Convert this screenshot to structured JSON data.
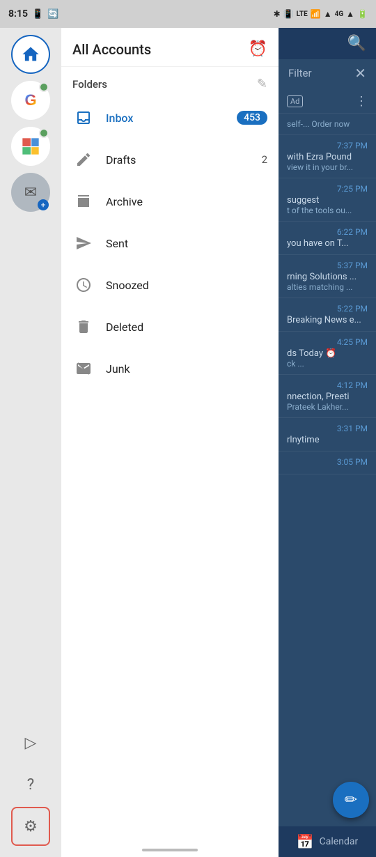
{
  "statusBar": {
    "time": "8:15",
    "icons": [
      "phone-icon",
      "sync-icon",
      "bluetooth-icon",
      "vibrate-icon",
      "lte-icon",
      "wifi-icon",
      "signal-icon",
      "4g-icon",
      "signal2-icon",
      "battery-icon"
    ]
  },
  "sidebar": {
    "accounts": [
      {
        "id": "home",
        "type": "home",
        "active": true
      },
      {
        "id": "google",
        "type": "google",
        "dot": true
      },
      {
        "id": "office",
        "type": "office",
        "dot": true
      },
      {
        "id": "add",
        "type": "add"
      }
    ],
    "bottomIcons": [
      {
        "id": "play",
        "icon": "▷"
      },
      {
        "id": "help",
        "icon": "?"
      },
      {
        "id": "settings",
        "icon": "⚙",
        "active": true
      }
    ]
  },
  "folderPanel": {
    "title": "All Accounts",
    "foldersLabel": "Folders",
    "folders": [
      {
        "id": "inbox",
        "label": "Inbox",
        "icon": "inbox",
        "count": "453",
        "active": true
      },
      {
        "id": "drafts",
        "label": "Drafts",
        "icon": "drafts",
        "count": "2"
      },
      {
        "id": "archive",
        "label": "Archive",
        "icon": "archive",
        "count": ""
      },
      {
        "id": "sent",
        "label": "Sent",
        "icon": "sent",
        "count": ""
      },
      {
        "id": "snoozed",
        "label": "Snoozed",
        "icon": "snoozed",
        "count": ""
      },
      {
        "id": "deleted",
        "label": "Deleted",
        "icon": "deleted",
        "count": ""
      },
      {
        "id": "junk",
        "label": "Junk",
        "icon": "junk",
        "count": ""
      }
    ]
  },
  "emailPanel": {
    "filterLabel": "Filter",
    "emails": [
      {
        "time": "7:37 PM",
        "subject": "with Ezra Pound",
        "preview": "view it in your br..."
      },
      {
        "time": "7:25 PM",
        "subject": "suggest",
        "preview": "t of the tools ou..."
      },
      {
        "time": "6:22 PM",
        "subject": "you have on T...",
        "preview": ""
      },
      {
        "time": "5:37 PM",
        "subject": "rning Solutions ...",
        "preview": "alties matching ..."
      },
      {
        "time": "5:22 PM",
        "subject": "Breaking News e...",
        "preview": ""
      },
      {
        "time": "4:25 PM",
        "subject": "ds Today ⏰",
        "preview": "ck ..."
      },
      {
        "time": "4:12 PM",
        "subject": "nnection, Preeti",
        "preview": "Prateek Lakher..."
      },
      {
        "time": "3:31 PM",
        "subject": "rlnytime",
        "preview": ""
      },
      {
        "time": "3:05 PM",
        "subject": "",
        "preview": ""
      }
    ],
    "calendarLabel": "Calendar",
    "fabLabel": "✏"
  }
}
